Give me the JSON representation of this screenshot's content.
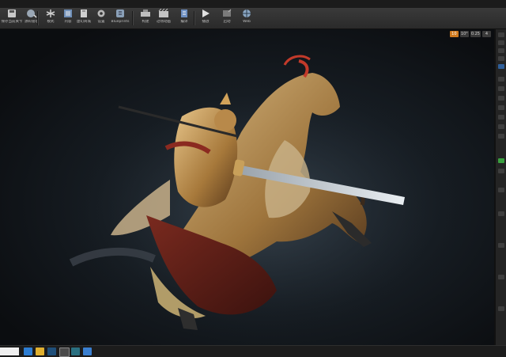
{
  "toolbar": {
    "buttons": [
      {
        "id": "save",
        "label": "保存当前关卡",
        "icon": "save-icon"
      },
      {
        "id": "source",
        "label": "源码管理",
        "icon": "source-control-icon"
      },
      {
        "id": "modes",
        "label": "模式",
        "icon": "modes-icon"
      },
      {
        "id": "content",
        "label": "内容",
        "icon": "content-browser-icon"
      },
      {
        "id": "market",
        "label": "虚幻商城",
        "icon": "marketplace-icon"
      },
      {
        "id": "settings",
        "label": "设置",
        "icon": "settings-icon"
      },
      {
        "id": "blueprints",
        "label": "Blueprints",
        "icon": "blueprints-icon"
      },
      {
        "id": "build",
        "label": "构建",
        "icon": "build-icon"
      },
      {
        "id": "cinematics",
        "label": "过场动画",
        "icon": "cinematics-icon"
      },
      {
        "id": "compile",
        "label": "编译",
        "icon": "compile-icon"
      },
      {
        "id": "play",
        "label": "播放",
        "icon": "play-icon"
      },
      {
        "id": "launch",
        "label": "启动",
        "icon": "launch-icon"
      },
      {
        "id": "web",
        "label": "Web",
        "icon": "globe-icon"
      }
    ]
  },
  "viewport": {
    "controls": [
      "10",
      "10°",
      "0.25",
      "4"
    ]
  },
  "colors": {
    "accent": "#d07a1f",
    "background": "#111111"
  }
}
